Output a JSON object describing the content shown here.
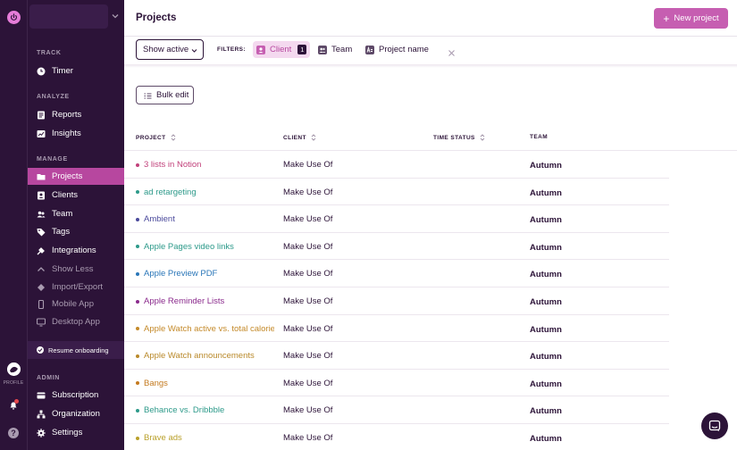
{
  "colors": {
    "sidebar_bg": "#2c1338",
    "active_nav": "#b7479f",
    "primary_button": "#c65eb1"
  },
  "rail": {
    "profile_label": "PROFILE"
  },
  "sidebar": {
    "sections": [
      {
        "label": "TRACK",
        "items": [
          {
            "label": "Timer",
            "icon": "clock-icon"
          }
        ]
      },
      {
        "label": "ANALYZE",
        "items": [
          {
            "label": "Reports",
            "icon": "reports-icon"
          },
          {
            "label": "Insights",
            "icon": "insights-icon"
          }
        ]
      },
      {
        "label": "MANAGE",
        "items": [
          {
            "label": "Projects",
            "icon": "folder-icon",
            "active": true
          },
          {
            "label": "Clients",
            "icon": "client-icon"
          },
          {
            "label": "Team",
            "icon": "team-icon"
          },
          {
            "label": "Tags",
            "icon": "tag-icon"
          },
          {
            "label": "Integrations",
            "icon": "puzzle-icon"
          },
          {
            "label": "Show Less",
            "icon": "chevron-up-icon"
          },
          {
            "label": "Import/Export",
            "icon": "import-export-icon"
          },
          {
            "label": "Mobile App",
            "icon": "mobile-icon"
          },
          {
            "label": "Desktop App",
            "icon": "desktop-icon"
          }
        ]
      },
      {
        "label": "ADMIN",
        "items": [
          {
            "label": "Subscription",
            "icon": "card-icon"
          },
          {
            "label": "Organization",
            "icon": "organization-icon"
          },
          {
            "label": "Settings",
            "icon": "gear-icon"
          }
        ]
      }
    ],
    "resume_onboarding": "Resume onboarding"
  },
  "header": {
    "title": "Projects",
    "new_project": "New project"
  },
  "filters": {
    "show_active": "Show active",
    "label": "FILTERS:",
    "chips": [
      {
        "label": "Client",
        "count": "1",
        "active": true
      },
      {
        "label": "Team"
      },
      {
        "label": "Project name"
      }
    ]
  },
  "bulk_edit": "Bulk edit",
  "table": {
    "columns": [
      "PROJECT",
      "CLIENT",
      "TIME STATUS",
      "TEAM"
    ],
    "rows": [
      {
        "project": "3 lists in Notion",
        "color": "#c1407a",
        "client": "Make Use Of",
        "team": "Autumn"
      },
      {
        "project": "ad retargeting",
        "color": "#2d9a8a",
        "client": "Make Use Of",
        "team": "Autumn"
      },
      {
        "project": "Ambient",
        "color": "#4b4a9c",
        "client": "Make Use Of",
        "team": "Autumn"
      },
      {
        "project": "Apple Pages video links",
        "color": "#2d9a8a",
        "client": "Make Use Of",
        "team": "Autumn"
      },
      {
        "project": "Apple Preview PDF",
        "color": "#2a76b8",
        "client": "Make Use Of",
        "team": "Autumn"
      },
      {
        "project": "Apple Reminder Lists",
        "color": "#8a2a8c",
        "client": "Make Use Of",
        "team": "Autumn"
      },
      {
        "project": "Apple Watch active vs. total calories",
        "color": "#c48a2a",
        "client": "Make Use Of",
        "team": "Autumn"
      },
      {
        "project": "Apple Watch announcements",
        "color": "#b9892a",
        "client": "Make Use Of",
        "team": "Autumn"
      },
      {
        "project": "Bangs",
        "color": "#c47a1f",
        "client": "Make Use Of",
        "team": "Autumn"
      },
      {
        "project": "Behance vs. Dribbble",
        "color": "#2d9a8a",
        "client": "Make Use Of",
        "team": "Autumn"
      },
      {
        "project": "Brave ads",
        "color": "#b9a02a",
        "client": "Make Use Of",
        "team": "Autumn"
      }
    ]
  }
}
